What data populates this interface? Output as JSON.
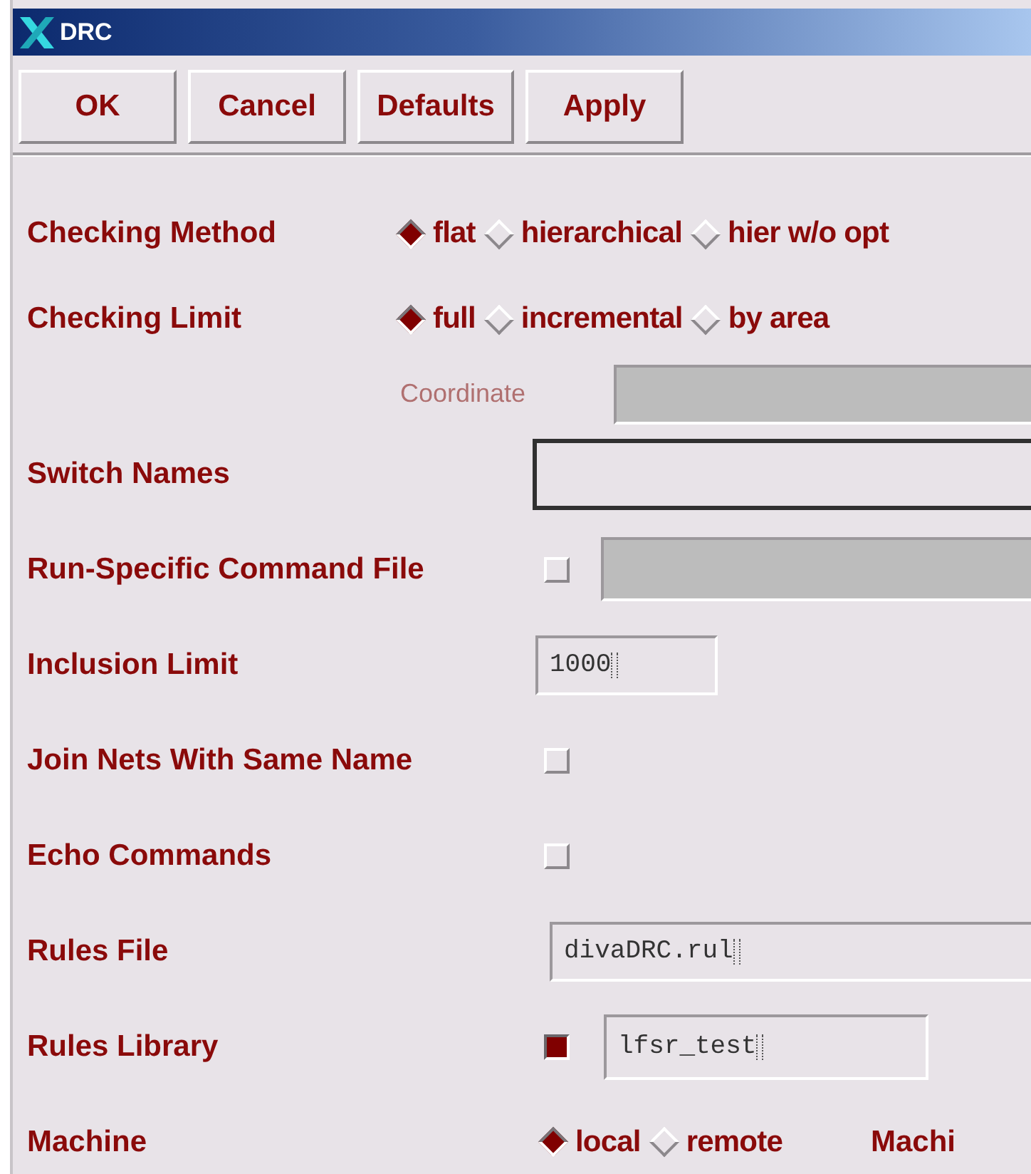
{
  "window": {
    "title": "DRC"
  },
  "buttons": [
    "OK",
    "Cancel",
    "Defaults",
    "Apply"
  ],
  "sections": [
    {
      "rows": [
        {
          "kind": "radio",
          "label": "Checking Method",
          "options": [
            {
              "label": "flat",
              "selected": true
            },
            {
              "label": "hierarchical",
              "selected": false
            },
            {
              "label": "hier w/o opt",
              "selected": false
            }
          ]
        },
        {
          "kind": "radio",
          "label": "Checking Limit",
          "options": [
            {
              "label": "full",
              "selected": true
            },
            {
              "label": "incremental",
              "selected": false
            },
            {
              "label": "by area",
              "selected": false
            }
          ]
        },
        {
          "kind": "subfield",
          "label": "Coordinate",
          "disabled": true
        }
      ]
    },
    {
      "rows": [
        {
          "kind": "field",
          "label": "Switch Names",
          "focused": true
        },
        {
          "kind": "checkfield",
          "label": "Run-Specific Command File",
          "checked": false
        },
        {
          "kind": "field",
          "label": "Inclusion Limit",
          "value": "1000",
          "focused": false
        },
        {
          "kind": "checkbox",
          "label": "Join Nets With Same Name",
          "checked": false
        },
        {
          "kind": "checkbox",
          "label": "Echo Commands",
          "checked": false
        },
        {
          "kind": "field",
          "label": "Rules File",
          "value": "divaDRC.rul",
          "focused": false
        },
        {
          "kind": "checkfield",
          "label": "Rules Library",
          "checked": true,
          "value": "lfsr_test"
        },
        {
          "kind": "radio",
          "label": "Machine",
          "options": [
            {
              "label": "local",
              "selected": true
            },
            {
              "label": "remote",
              "selected": false
            }
          ],
          "trailing": "Machi"
        }
      ]
    }
  ]
}
